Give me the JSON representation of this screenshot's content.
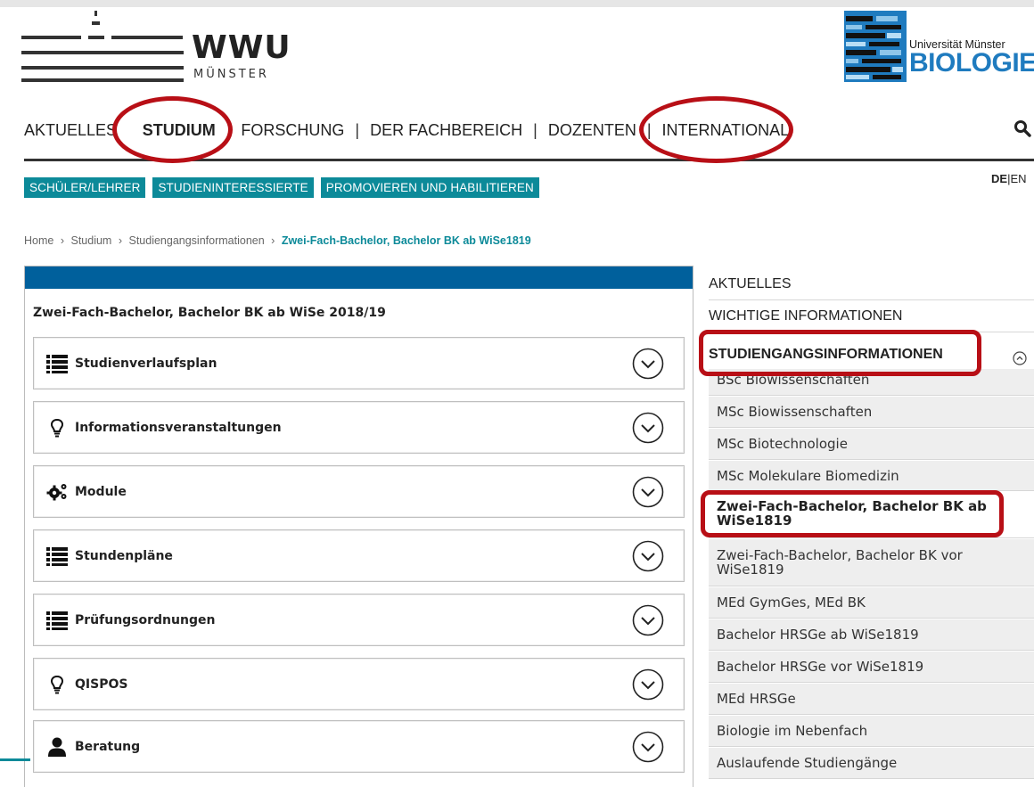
{
  "header": {
    "wwu_word": "WWU",
    "wwu_sub": "MÜNSTER",
    "bio_uni": "Universität Münster",
    "bio_word": "BIOLOGIE"
  },
  "mainnav": {
    "items": [
      "AKTUELLES",
      "STUDIUM",
      "FORSCHUNG",
      "DER FACHBEREICH",
      "DOZENTEN",
      "INTERNATIONAL"
    ],
    "separator": "|",
    "active": "STUDIUM",
    "search_icon": "search-icon"
  },
  "subnav": {
    "items": [
      "SCHÜLER/LEHRER",
      "STUDIENINTERESSIERTE",
      "PROMOVIEREN UND HABILITIEREN"
    ],
    "lang_de": "DE",
    "lang_sep": "|",
    "lang_en": "EN"
  },
  "breadcrumb": {
    "items": [
      "Home",
      "Studium",
      "Studiengangsinformationen"
    ],
    "current": "Zwei-Fach-Bachelor, Bachelor BK ab WiSe1819",
    "separator": "›"
  },
  "content": {
    "title": "Zwei-Fach-Bachelor, Bachelor BK ab WiSe 2018/19",
    "accordion": [
      {
        "label": "Studienverlaufsplan",
        "icon": "list-icon"
      },
      {
        "label": "Informationsveranstaltungen",
        "icon": "lightbulb-icon"
      },
      {
        "label": "Module",
        "icon": "gears-icon"
      },
      {
        "label": "Stundenpläne",
        "icon": "list-icon"
      },
      {
        "label": "Prüfungsordnungen",
        "icon": "list-icon"
      },
      {
        "label": "QISPOS",
        "icon": "lightbulb-icon"
      },
      {
        "label": "Beratung",
        "icon": "user-icon"
      }
    ]
  },
  "sidebar": {
    "top_items": [
      "AKTUELLES",
      "WICHTIGE INFORMATIONEN",
      "STUDIENGANGSINFORMATIONEN"
    ],
    "sub_items": [
      "BSc Biowissenschaften",
      "MSc Biowissenschaften",
      "MSc Biotechnologie",
      "MSc Molekulare Biomedizin",
      "Zwei-Fach-Bachelor, Bachelor BK ab WiSe1819",
      "Zwei-Fach-Bachelor, Bachelor BK vor WiSe1819",
      "MEd GymGes, MEd BK",
      "Bachelor HRSGe ab WiSe1819",
      "Bachelor HRSGe vor WiSe1819",
      "MEd HRSGe",
      "Biologie im Nebenfach",
      "Auslaufende Studiengänge"
    ],
    "active_sub": "Zwei-Fach-Bachelor, Bachelor BK ab WiSe1819",
    "collapse_icon": "chevron-up-circle-icon"
  },
  "colors": {
    "teal": "#0c8a99",
    "blue_bar": "#00609c",
    "annotation_red": "#b80f16",
    "biologie_blue": "#1f7bbf"
  }
}
